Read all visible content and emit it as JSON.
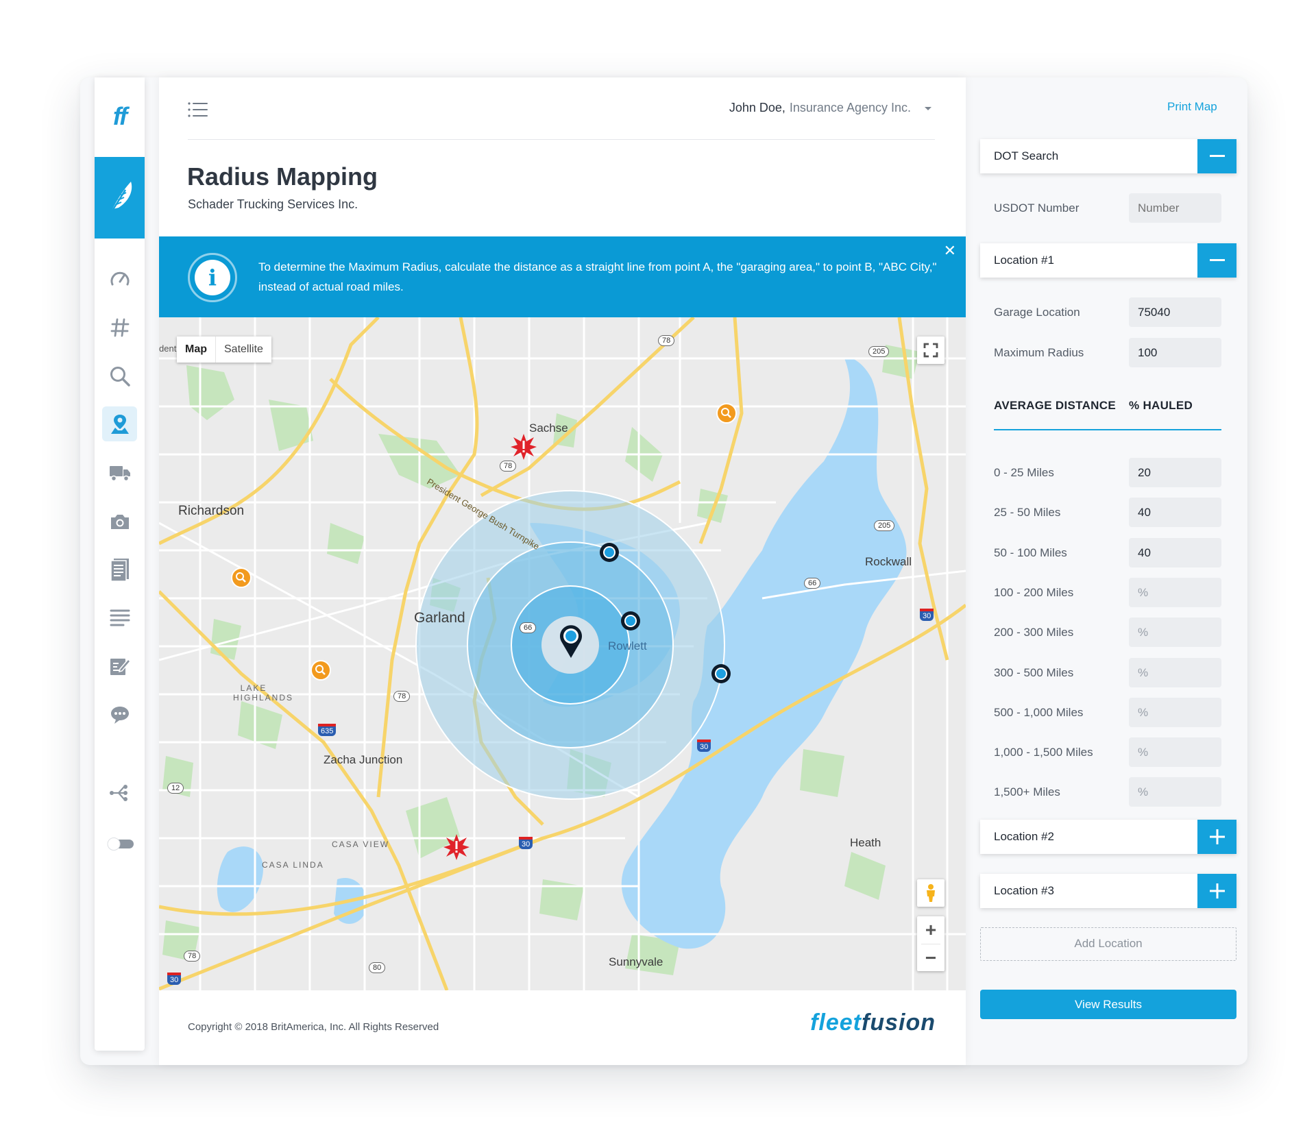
{
  "app": {
    "logo_text": "ff"
  },
  "header": {
    "user_name": "John Doe,",
    "organization": "Insurance Agency Inc.",
    "title": "Radius Mapping",
    "subtitle": "Schader Trucking Services Inc."
  },
  "sidebar": {
    "items": [
      {
        "name": "dashboard",
        "icon": "speedometer-icon"
      },
      {
        "name": "numbers",
        "icon": "hash-icon"
      },
      {
        "name": "search",
        "icon": "search-icon"
      },
      {
        "name": "radius-mapping",
        "icon": "map-pin-icon",
        "active": true
      },
      {
        "name": "trucks",
        "icon": "truck-icon"
      },
      {
        "name": "camera",
        "icon": "camera-icon"
      },
      {
        "name": "documents",
        "icon": "document-icon"
      },
      {
        "name": "list",
        "icon": "list-icon"
      },
      {
        "name": "edit",
        "icon": "edit-icon"
      },
      {
        "name": "messages",
        "icon": "chat-icon"
      },
      {
        "name": "share",
        "icon": "share-icon"
      },
      {
        "name": "toggle",
        "icon": "toggle-icon"
      }
    ]
  },
  "info_banner": {
    "text": "To determine the Maximum Radius, calculate the distance as a straight line from point A, the \"garaging area,\" to point B, \"ABC City,\" instead of actual road miles."
  },
  "map": {
    "type_map": "Map",
    "type_satellite": "Satellite",
    "labels": {
      "sachse": "Sachse",
      "richardson": "Richardson",
      "garland": "Garland",
      "rowlett": "Rowlett",
      "rockwall": "Rockwall",
      "lake_highlands_1": "LAKE",
      "lake_highlands_2": "HIGHLANDS",
      "zacha_junction": "Zacha Junction",
      "casa_view": "CASA VIEW",
      "casa_linda": "CASA LINDA",
      "heath": "Heath",
      "sunnyvale": "Sunnyvale",
      "turnpike": "President George Bush Turnpike",
      "edge": "dent"
    },
    "shields": {
      "s78a": "78",
      "s205a": "205",
      "s78b": "78",
      "s205b": "205",
      "s66a": "66",
      "s66b": "66",
      "s30a": "30",
      "s30b": "30",
      "s30c": "30",
      "s30d": "30",
      "s78c": "78",
      "s635": "635",
      "s12": "12",
      "s78d": "78",
      "s80": "80"
    },
    "zoom_in": "+",
    "zoom_out": "−"
  },
  "footer": {
    "copyright": "Copyright © 2018 BritAmerica, Inc. All Rights Reserved",
    "brand_fleet": "fleet",
    "brand_fusion": "fusion"
  },
  "panel": {
    "print_map": "Print Map",
    "dot_search": "DOT Search",
    "usdot_label": "USDOT Number",
    "usdot_placeholder": "Number",
    "location1": "Location #1",
    "garage_label": "Garage Location",
    "garage_value": "75040",
    "max_radius_label": "Maximum Radius",
    "max_radius_value": "100",
    "col_distance": "AVERAGE DISTANCE",
    "col_hauled": "% HAULED",
    "distance_rows": [
      {
        "label": "0 - 25 Miles",
        "value": "20"
      },
      {
        "label": "25 - 50 Miles",
        "value": "40"
      },
      {
        "label": "50 - 100 Miles",
        "value": "40"
      },
      {
        "label": "100 - 200 Miles",
        "value": "%"
      },
      {
        "label": "200 - 300 Miles",
        "value": "%"
      },
      {
        "label": "300 - 500 Miles",
        "value": "%"
      },
      {
        "label": "500 - 1,000 Miles",
        "value": "%"
      },
      {
        "label": "1,000 - 1,500 Miles",
        "value": "%"
      },
      {
        "label": "1,500+ Miles",
        "value": "%"
      }
    ],
    "location2": "Location #2",
    "location3": "Location #3",
    "add_location": "Add Location",
    "view_results": "View Results"
  },
  "colors": {
    "accent": "#14a2dc",
    "text_dark": "#2f3742",
    "water": "#a9d8f8",
    "road": "#f7d46a",
    "park": "#c8e6c0"
  }
}
